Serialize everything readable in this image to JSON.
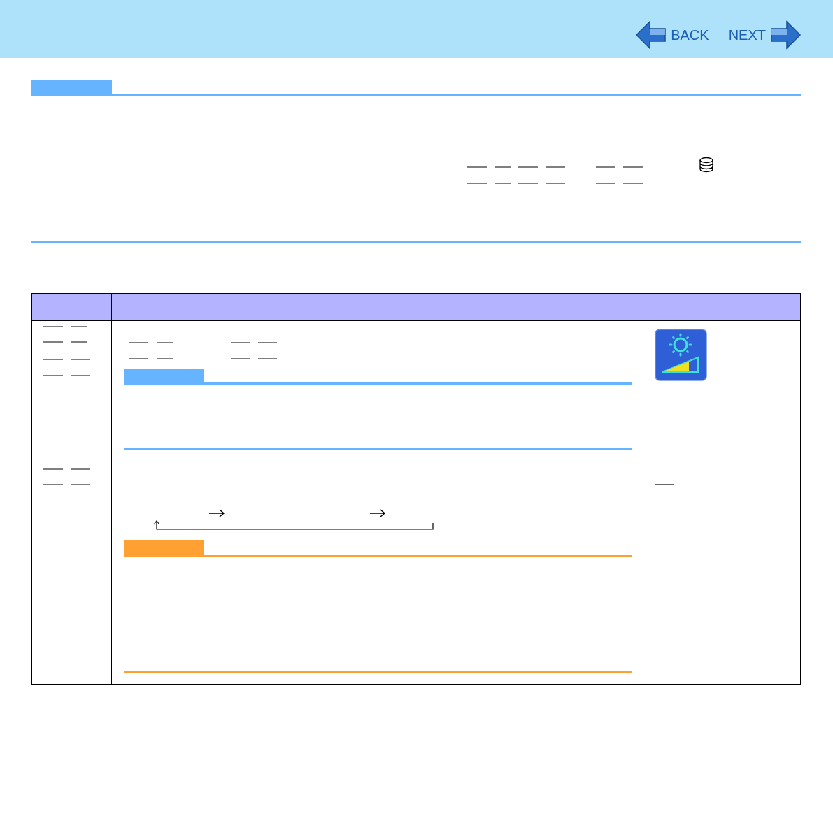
{
  "nav": [
    {
      "label": "BACK",
      "kind": "back"
    },
    {
      "label": "NEXT",
      "kind": "next"
    }
  ]
}
